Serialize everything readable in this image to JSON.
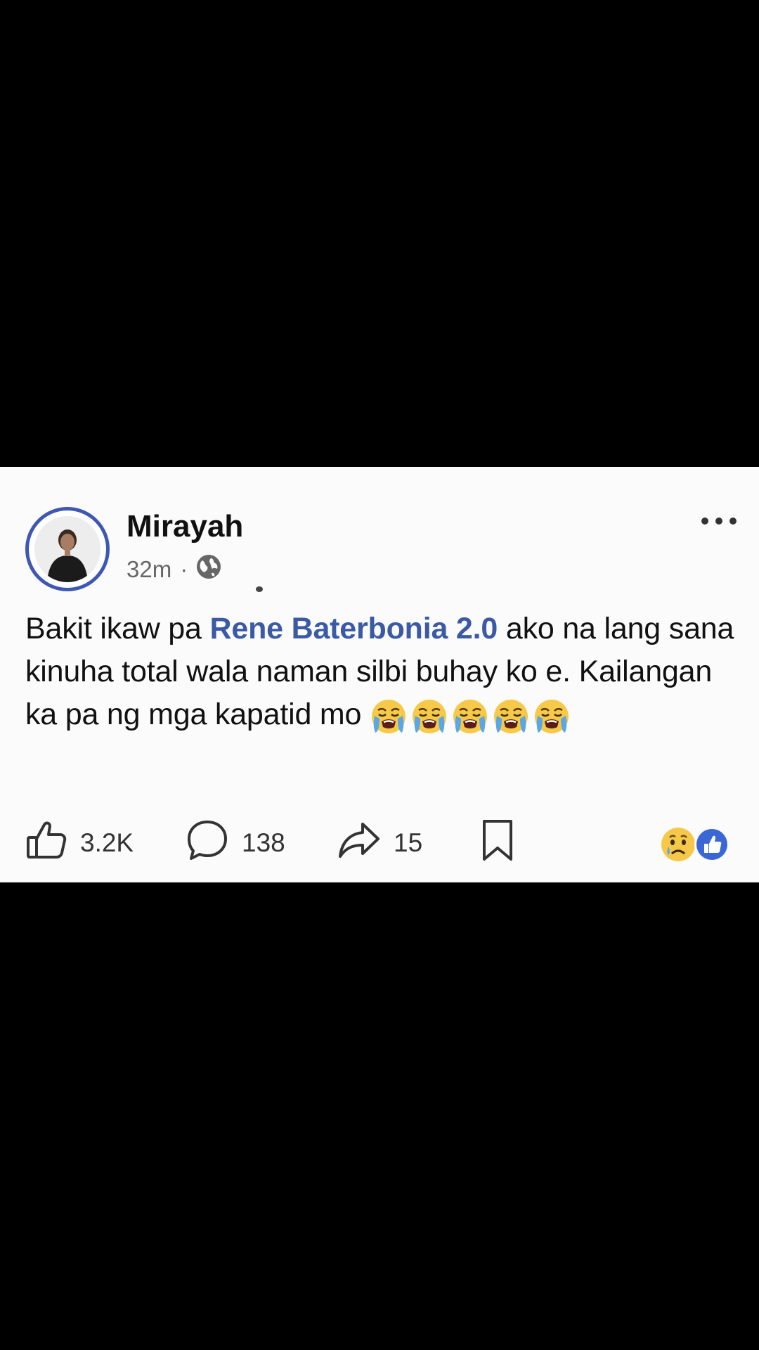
{
  "post": {
    "author": "Mirayah",
    "time": "32m",
    "separator": "·",
    "visibility_icon": "globe-icon",
    "text_before": "Bakit ikaw pa ",
    "mention": "Rene Baterbonia 2.0",
    "text_after": " ako na lang sana kinuha total wala naman silbi buhay ko e. Kailangan ka pa ng mga kapatid mo ",
    "emojis": [
      "loudly-crying-face-emoji",
      "loudly-crying-face-emoji",
      "loudly-crying-face-emoji",
      "loudly-crying-face-emoji",
      "loudly-crying-face-emoji"
    ]
  },
  "actions": {
    "like_count": "3.2K",
    "comment_count": "138",
    "share_count": "15"
  },
  "reactions": [
    "sad-face-emoji",
    "like-icon"
  ],
  "colors": {
    "mention": "#3b5aa5",
    "avatar_ring": "#3d57b3",
    "like_reaction": "#3b66d6"
  }
}
